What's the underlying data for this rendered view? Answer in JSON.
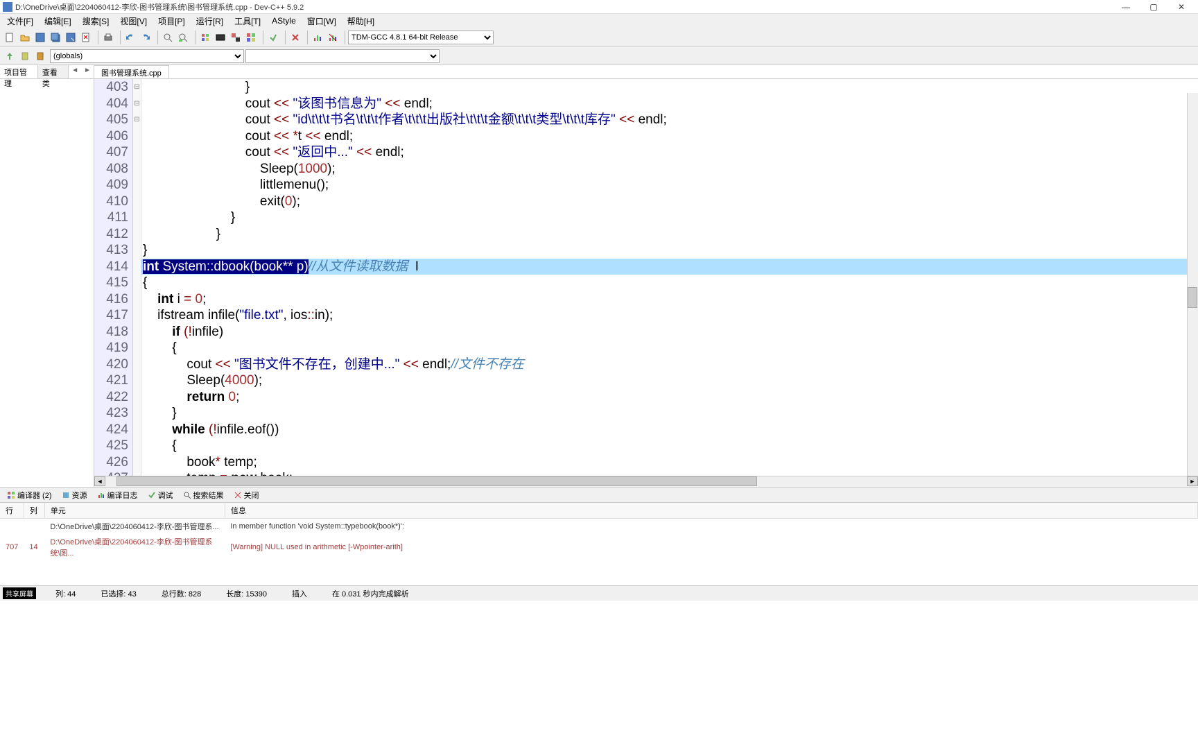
{
  "title": "D:\\OneDrive\\桌面\\2204060412-李欣-图书管理系统\\图书管理系统.cpp - Dev-C++ 5.9.2",
  "menus": [
    "文件[F]",
    "编辑[E]",
    "搜索[S]",
    "视图[V]",
    "项目[P]",
    "运行[R]",
    "工具[T]",
    "AStyle",
    "窗口[W]",
    "帮助[H]"
  ],
  "compiler_select": "TDM-GCC 4.8.1 64-bit Release",
  "globals": "(globals)",
  "sidebar_tabs": {
    "a": "项目管理",
    "b": "查看类"
  },
  "editor_tab": "图书管理系统.cpp",
  "lines": [
    {
      "n": "403",
      "f": " ",
      "txt": [
        [
          "                            ",
          "p"
        ],
        [
          "}",
          "p"
        ]
      ]
    },
    {
      "n": "404",
      "f": " ",
      "txt": [
        [
          "                            cout ",
          "p"
        ],
        [
          "<<",
          "op"
        ],
        [
          " ",
          "p"
        ],
        [
          "\"该图书信息为\"",
          "str"
        ],
        [
          " ",
          "p"
        ],
        [
          "<<",
          "op"
        ],
        [
          " endl",
          "p"
        ],
        [
          ";",
          "p"
        ]
      ]
    },
    {
      "n": "405",
      "f": " ",
      "txt": [
        [
          "                            cout ",
          "p"
        ],
        [
          "<<",
          "op"
        ],
        [
          " ",
          "p"
        ],
        [
          "\"id\\t\\t\\t书名\\t\\t\\t作者\\t\\t\\t出版社\\t\\t\\t金额\\t\\t\\t类型\\t\\t\\t库存\"",
          "str"
        ],
        [
          " ",
          "p"
        ],
        [
          "<<",
          "op"
        ],
        [
          " endl",
          "p"
        ],
        [
          ";",
          "p"
        ]
      ]
    },
    {
      "n": "406",
      "f": " ",
      "txt": [
        [
          "                            cout ",
          "p"
        ],
        [
          "<<",
          "op"
        ],
        [
          " ",
          "p"
        ],
        [
          "*",
          "op"
        ],
        [
          "t ",
          "p"
        ],
        [
          "<<",
          "op"
        ],
        [
          " endl",
          "p"
        ],
        [
          ";",
          "p"
        ]
      ]
    },
    {
      "n": "407",
      "f": " ",
      "txt": [
        [
          "                            cout ",
          "p"
        ],
        [
          "<<",
          "op"
        ],
        [
          " ",
          "p"
        ],
        [
          "\"返回中...\"",
          "str"
        ],
        [
          " ",
          "p"
        ],
        [
          "<<",
          "op"
        ],
        [
          " endl",
          "p"
        ],
        [
          ";",
          "p"
        ]
      ]
    },
    {
      "n": "408",
      "f": " ",
      "txt": [
        [
          "                                Sleep",
          "p"
        ],
        [
          "(",
          "p"
        ],
        [
          "1000",
          "num"
        ],
        [
          ")",
          "p"
        ],
        [
          ";",
          "p"
        ]
      ]
    },
    {
      "n": "409",
      "f": " ",
      "txt": [
        [
          "                                littlemenu",
          "p"
        ],
        [
          "()",
          "p"
        ],
        [
          ";",
          "p"
        ]
      ]
    },
    {
      "n": "410",
      "f": " ",
      "txt": [
        [
          "                                exit",
          "p"
        ],
        [
          "(",
          "p"
        ],
        [
          "0",
          "num"
        ],
        [
          ")",
          "p"
        ],
        [
          ";",
          "p"
        ]
      ]
    },
    {
      "n": "411",
      "f": " ",
      "txt": [
        [
          "                        ",
          "p"
        ],
        [
          "}",
          "p"
        ]
      ]
    },
    {
      "n": "412",
      "f": " ",
      "txt": [
        [
          "                    ",
          "p"
        ],
        [
          "}",
          "p"
        ]
      ]
    },
    {
      "n": "413",
      "f": " ",
      "txt": [
        [
          "",
          "p"
        ],
        [
          "}",
          "p"
        ]
      ]
    },
    {
      "n": "414",
      "f": " ",
      "hl": true,
      "sel": true,
      "seltxt": "int System::dbook(book** p)",
      "cmt": "//从文件读取数据",
      "cursor": true
    },
    {
      "n": "415",
      "f": "⊟",
      "txt": [
        [
          "",
          "p"
        ],
        [
          "{",
          "p"
        ]
      ]
    },
    {
      "n": "416",
      "f": " ",
      "txt": [
        [
          "    ",
          "p"
        ],
        [
          "int",
          "kw"
        ],
        [
          " i ",
          "p"
        ],
        [
          "=",
          "op"
        ],
        [
          " ",
          "p"
        ],
        [
          "0",
          "num"
        ],
        [
          ";",
          "p"
        ]
      ]
    },
    {
      "n": "417",
      "f": " ",
      "txt": [
        [
          "    ifstream infile",
          "p"
        ],
        [
          "(",
          "p"
        ],
        [
          "\"file.txt\"",
          "str"
        ],
        [
          ",",
          "p"
        ],
        [
          " ios",
          "p"
        ],
        [
          "::",
          "op"
        ],
        [
          "in",
          "p"
        ],
        [
          ")",
          "p"
        ],
        [
          ";",
          "p"
        ]
      ]
    },
    {
      "n": "418",
      "f": " ",
      "txt": [
        [
          "        ",
          "p"
        ],
        [
          "if",
          "kw"
        ],
        [
          " ",
          "p"
        ],
        [
          "(!",
          "op"
        ],
        [
          "infile",
          "p"
        ],
        [
          ")",
          "p"
        ]
      ]
    },
    {
      "n": "419",
      "f": "⊟",
      "txt": [
        [
          "        ",
          "p"
        ],
        [
          "{",
          "p"
        ]
      ]
    },
    {
      "n": "420",
      "f": " ",
      "txt": [
        [
          "            cout ",
          "p"
        ],
        [
          "<<",
          "op"
        ],
        [
          " ",
          "p"
        ],
        [
          "\"图书文件不存在，创建中...\"",
          "str"
        ],
        [
          " ",
          "p"
        ],
        [
          "<<",
          "op"
        ],
        [
          " endl",
          "p"
        ],
        [
          ";",
          "p"
        ],
        [
          "//文件不存在",
          "cmt"
        ]
      ]
    },
    {
      "n": "421",
      "f": " ",
      "txt": [
        [
          "            Sleep",
          "p"
        ],
        [
          "(",
          "p"
        ],
        [
          "4000",
          "num"
        ],
        [
          ")",
          "p"
        ],
        [
          ";",
          "p"
        ]
      ]
    },
    {
      "n": "422",
      "f": " ",
      "txt": [
        [
          "            ",
          "p"
        ],
        [
          "return",
          "kw"
        ],
        [
          " ",
          "p"
        ],
        [
          "0",
          "num"
        ],
        [
          ";",
          "p"
        ]
      ]
    },
    {
      "n": "423",
      "f": " ",
      "txt": [
        [
          "        ",
          "p"
        ],
        [
          "}",
          "p"
        ]
      ]
    },
    {
      "n": "424",
      "f": " ",
      "txt": [
        [
          "        ",
          "p"
        ],
        [
          "while",
          "kw"
        ],
        [
          " ",
          "p"
        ],
        [
          "(!",
          "op"
        ],
        [
          "infile",
          "p"
        ],
        [
          ".",
          "p"
        ],
        [
          "eof",
          "p"
        ],
        [
          "())",
          "p"
        ]
      ]
    },
    {
      "n": "425",
      "f": "⊟",
      "txt": [
        [
          "        ",
          "p"
        ],
        [
          "{",
          "p"
        ]
      ]
    },
    {
      "n": "426",
      "f": " ",
      "txt": [
        [
          "            book",
          "p"
        ],
        [
          "*",
          "op"
        ],
        [
          " temp",
          "p"
        ],
        [
          ";",
          "p"
        ]
      ]
    },
    {
      "n": "427",
      "f": " ",
      "txt": [
        [
          "            temp ",
          "p"
        ],
        [
          "=",
          "op"
        ],
        [
          " ",
          "p"
        ],
        [
          "new",
          "kw"
        ],
        [
          " book",
          "p"
        ],
        [
          ";",
          "p"
        ]
      ]
    }
  ],
  "bottom_tabs": {
    "a": "编译器 (2)",
    "b": "资源",
    "c": "编译日志",
    "d": "调试",
    "e": "搜索结果",
    "f": "关闭"
  },
  "table": {
    "headers": {
      "line": "行",
      "col": "列",
      "unit": "单元",
      "info": "信息"
    },
    "rows": [
      {
        "line": "",
        "col": "",
        "unit": "D:\\OneDrive\\桌面\\2204060412-李欣-图书管理系...",
        "info": "In member function 'void System::typebook(book*)':",
        "cls": "inf"
      },
      {
        "line": "707",
        "col": "14",
        "unit": "D:\\OneDrive\\桌面\\2204060412-李欣-图书管理系统\\图...",
        "info": "[Warning] NULL used in arithmetic [-Wpointer-arith]",
        "cls": "wrn"
      }
    ]
  },
  "status": {
    "share": "共享屏幕",
    "col_lbl": "列:",
    "col": "44",
    "sel_lbl": "已选择:",
    "sel": "43",
    "total_lbl": "总行数:",
    "total": "828",
    "len_lbl": "长度:",
    "len": "15390",
    "mode": "插入",
    "parse": "在 0.031 秒内完成解析"
  }
}
